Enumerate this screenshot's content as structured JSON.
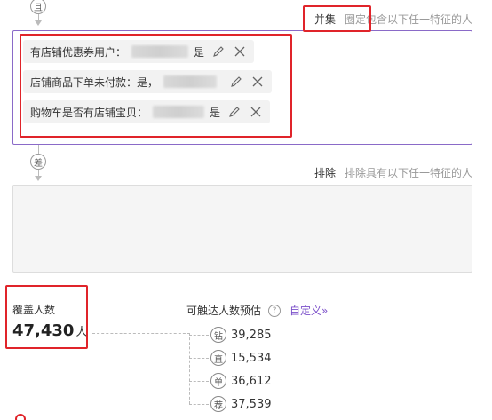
{
  "top_connector": {
    "symbol": "且"
  },
  "include_panel": {
    "mode_label": "并集",
    "description": "圈定包含以下任一特征的人",
    "conditions": [
      {
        "label": "有店铺优惠券用户：",
        "value": "是"
      },
      {
        "label": "店铺商品下单未付款：",
        "value": "是，"
      },
      {
        "label": "购物车是否有店铺宝贝：",
        "value": "是"
      }
    ]
  },
  "middle_connector": {
    "symbol": "差"
  },
  "exclude_panel": {
    "mode_label": "排除",
    "description": "排除具有以下任一特征的人"
  },
  "coverage": {
    "label": "覆盖人数",
    "count": "47,430",
    "unit": "人"
  },
  "reach": {
    "title": "可触达人数预估",
    "help_symbol": "?",
    "custom_link": "自定义»",
    "channels": [
      {
        "icon": "钻",
        "value": "39,285"
      },
      {
        "icon": "直",
        "value": "15,534"
      },
      {
        "icon": "单",
        "value": "36,612"
      },
      {
        "icon": "荐",
        "value": "37,539"
      }
    ]
  },
  "colors": {
    "accent": "#7b4fc9",
    "highlight_frame": "#e0242a",
    "panel_border": "#8a6ac8"
  }
}
